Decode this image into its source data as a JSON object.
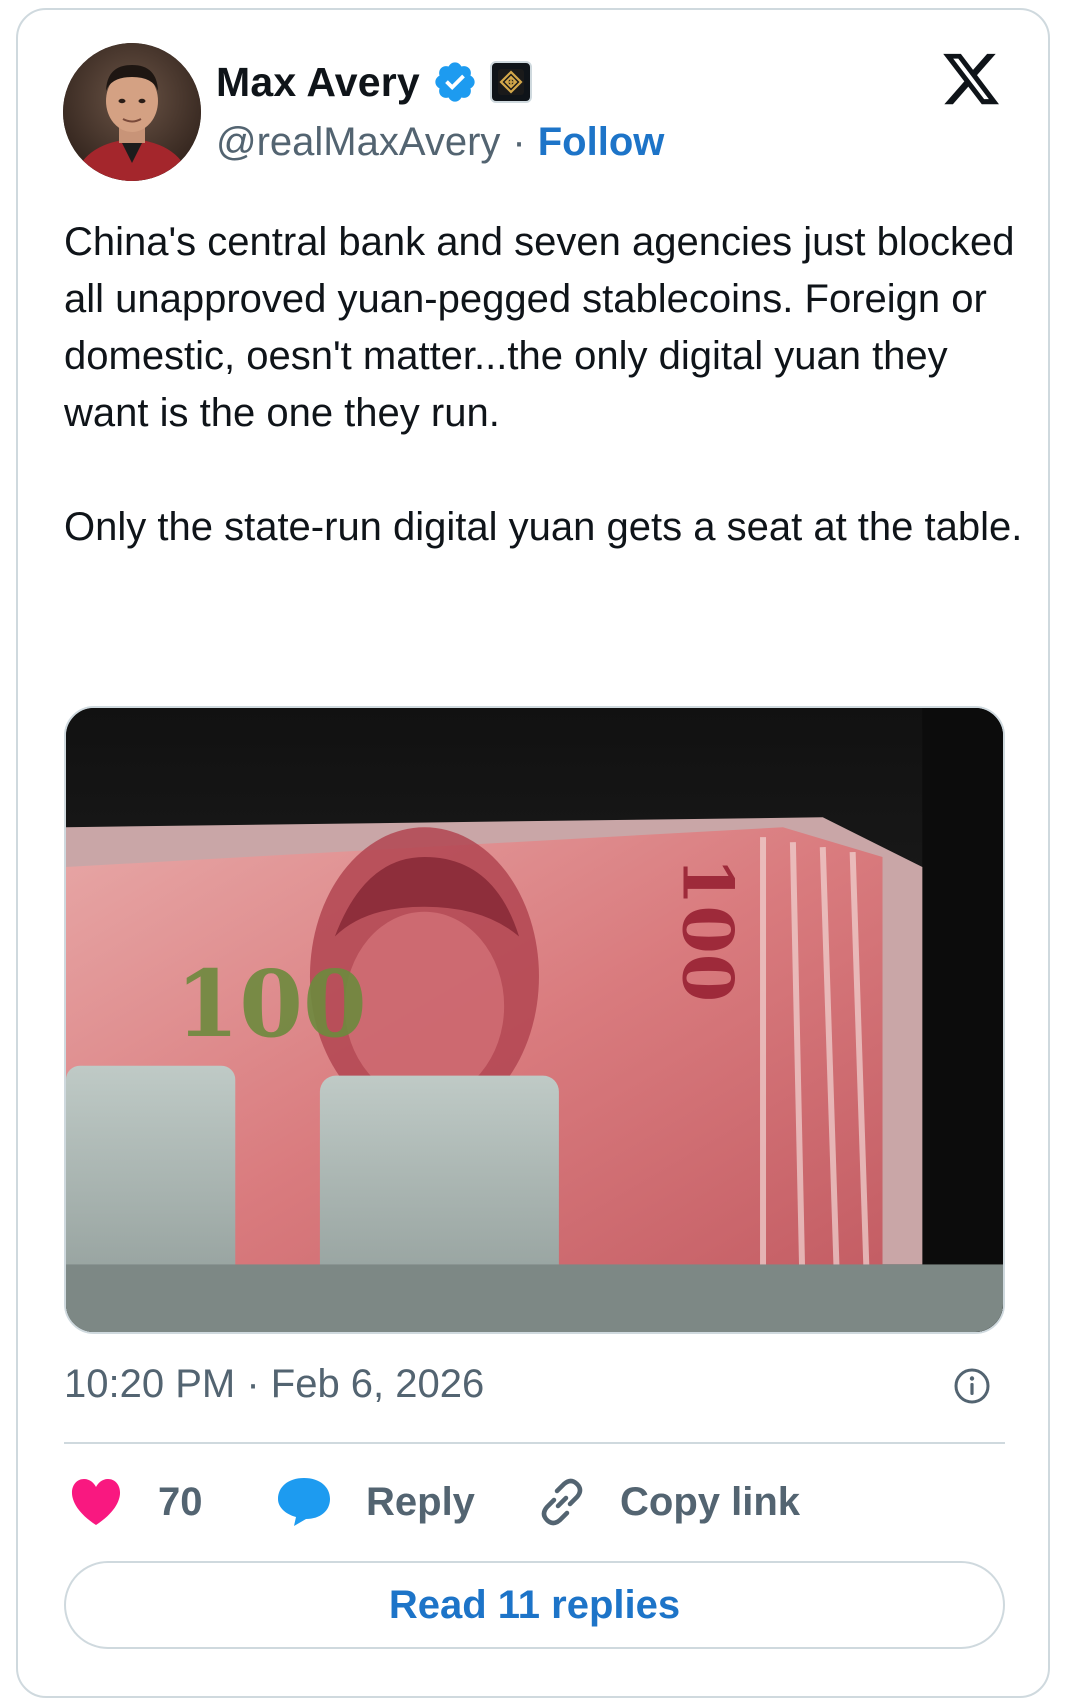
{
  "author": {
    "display_name": "Max Avery",
    "handle": "@realMaxAvery",
    "separator": "·",
    "follow_label": "Follow",
    "verified": true
  },
  "tweet": {
    "paragraphs": [
      "China's central bank and seven agencies just blocked all unapproved yuan-pegged stablecoins. Foreign or domestic, oesn't matter...the only digital yuan they want is the one they run.",
      "Only the state-run digital yuan gets a seat at the table."
    ],
    "timestamp": "10:20 PM · Feb 6, 2026"
  },
  "actions": {
    "like_count": "70",
    "reply_label": "Reply",
    "copy_label": "Copy link"
  },
  "read_replies_label": "Read 11 replies",
  "colors": {
    "accent": "#1d9bf0",
    "link": "#1d74c8",
    "like": "#f91880",
    "muted": "#536471",
    "border": "#cfd9de"
  },
  "icons": {
    "brand": "x-logo-icon",
    "verified": "verified-badge-icon",
    "affiliate": "affiliate-badge-icon",
    "info": "info-icon",
    "like": "heart-icon",
    "reply": "speech-bubble-icon",
    "copy": "link-icon"
  }
}
